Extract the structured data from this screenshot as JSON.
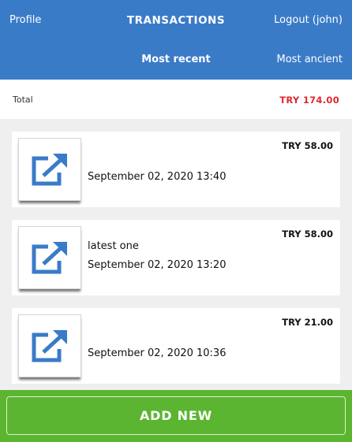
{
  "header": {
    "profile_label": "Profile",
    "title": "TRANSACTIONS",
    "logout_label": "Logout (john)",
    "sort_recent_label": "Most recent",
    "sort_ancient_label": "Most ancient"
  },
  "total": {
    "label": "Total",
    "value": "TRY 174.00"
  },
  "transactions": [
    {
      "amount": "TRY 58.00",
      "note": "",
      "date": "September 02, 2020 13:40",
      "icon": "external-link-icon"
    },
    {
      "amount": "TRY 58.00",
      "note": "latest one",
      "date": "September 02, 2020 13:20",
      "icon": "external-link-icon"
    },
    {
      "amount": "TRY 21.00",
      "note": "",
      "date": "September 02, 2020 10:36",
      "icon": "external-link-icon"
    }
  ],
  "footer": {
    "add_label": "ADD NEW"
  },
  "colors": {
    "header": "#3a7bc8",
    "total_value": "#e0282f",
    "footer": "#5cb531",
    "icon": "#3a7bc8"
  }
}
